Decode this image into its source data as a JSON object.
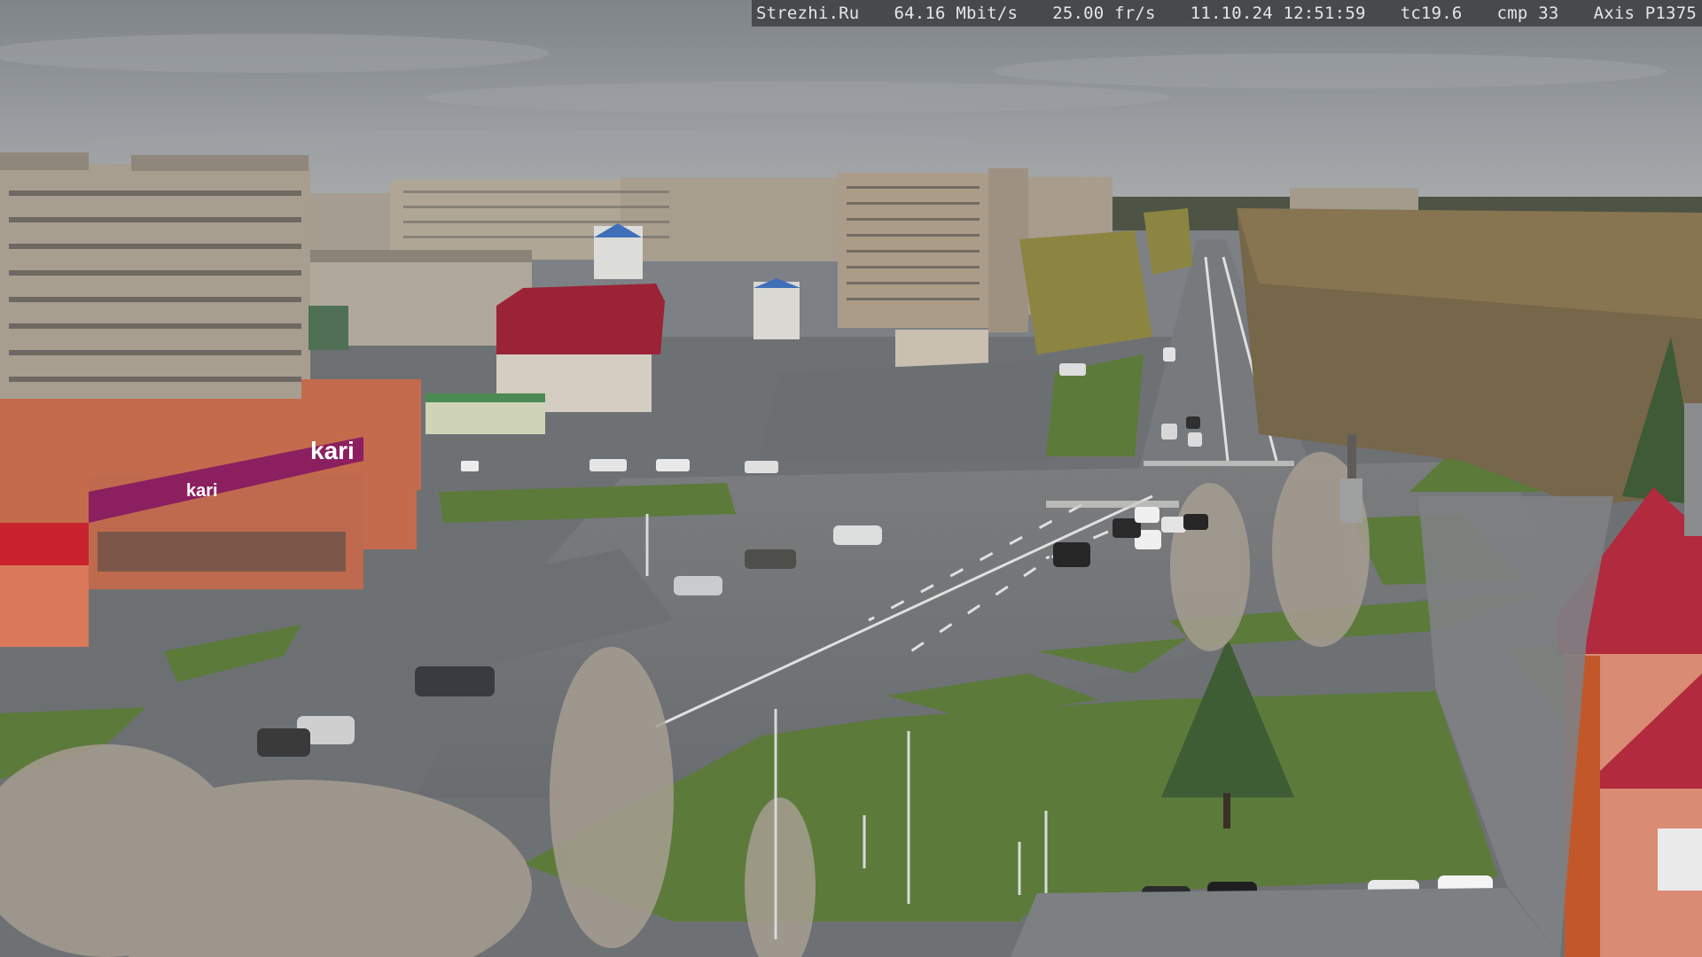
{
  "overlay": {
    "site": "Strezhi.Ru",
    "bitrate": "64.16 Mbit/s",
    "framerate": "25.00 fr/s",
    "datetime": "11.10.24 12:51:59",
    "tc": "tc19.6",
    "cmp": "cmp 33",
    "camera": "Axis P1375"
  },
  "scene": {
    "store_sign": "kari",
    "store_sign_lower": "kari"
  },
  "colors": {
    "sky": "#888d92",
    "asphalt": "#6f7275",
    "grass": "#5f7a3c",
    "store_magenta": "#8b1f5f",
    "building_orange": "#c86a4a",
    "roof_red": "#b3263a"
  }
}
